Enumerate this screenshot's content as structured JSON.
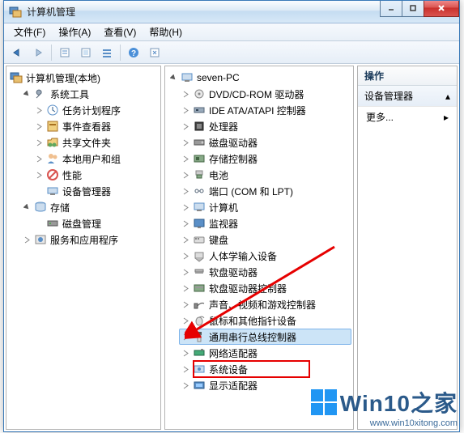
{
  "window": {
    "title": "计算机管理"
  },
  "menu": {
    "file": "文件(F)",
    "action": "操作(A)",
    "view": "查看(V)",
    "help": "帮助(H)"
  },
  "leftTree": {
    "root": "计算机管理(本地)",
    "systools": "系统工具",
    "systools_items": {
      "task": "任务计划程序",
      "event": "事件查看器",
      "share": "共享文件夹",
      "users": "本地用户和组",
      "perf": "性能",
      "devmgr": "设备管理器"
    },
    "storage": "存储",
    "storage_items": {
      "disk": "磁盘管理"
    },
    "services": "服务和应用程序"
  },
  "midTree": {
    "root": "seven-PC",
    "items": [
      "DVD/CD-ROM 驱动器",
      "IDE ATA/ATAPI 控制器",
      "处理器",
      "磁盘驱动器",
      "存储控制器",
      "电池",
      "端口 (COM 和 LPT)",
      "计算机",
      "监视器",
      "键盘",
      "人体学输入设备",
      "软盘驱动器",
      "软盘驱动器控制器",
      "声音、视频和游戏控制器",
      "鼠标和其他指针设备",
      "通用串行总线控制器",
      "网络适配器",
      "系统设备",
      "显示适配器"
    ]
  },
  "actions": {
    "header": "操作",
    "devmgr": "设备管理器",
    "more": "更多..."
  },
  "watermark": {
    "brand": "Win10之家",
    "url": "www.win10xitong.com"
  }
}
